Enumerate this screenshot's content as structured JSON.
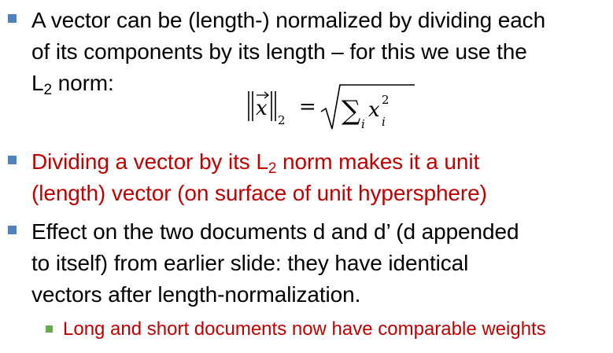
{
  "bullets": [
    {
      "text_line1": "A vector can be (length-) normalized by dividing each",
      "text_line2": "of its components by its length – for this we use the",
      "text_line3_pre": "L",
      "text_line3_sub": "2",
      "text_line3_post": " norm:"
    },
    {
      "text_line1_pre": "Dividing a vector by its L",
      "text_line1_sub": "2",
      "text_line1_post": " norm makes it a unit",
      "text_line2": "(length) vector (on surface of unit hypersphere)",
      "color": "#c00000"
    },
    {
      "text_line1": "Effect on the two documents d and d’ (d appended",
      "text_line2": "to itself) from earlier slide: they have identical",
      "text_line3": "vectors after length-normalization."
    }
  ],
  "sub_bullet": {
    "text": "Long and short documents now have comparable weights",
    "color": "#c00000"
  },
  "formula": {
    "var": "x",
    "norm_sub": "2",
    "equals": "=",
    "sum_sub": "i",
    "term_var": "x",
    "term_sub": "i",
    "term_sup": "2"
  },
  "colors": {
    "bullet_marker": "#4f81bd",
    "sub_marker": "#6aa84f",
    "emphasis": "#c00000"
  }
}
